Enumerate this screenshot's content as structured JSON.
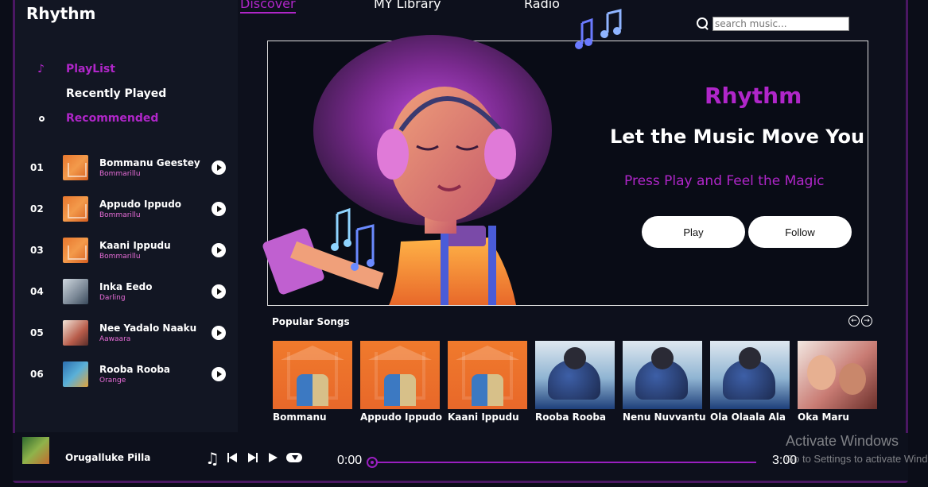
{
  "app": {
    "brand": "Rhythm"
  },
  "nav": {
    "discover": "Discover",
    "library": "MY Library",
    "radio": "Radio"
  },
  "search": {
    "placeholder": "search music..."
  },
  "sidebar": {
    "menu": [
      {
        "label": "PlayList",
        "icon": "music-note-icon"
      },
      {
        "label": "Recently Played",
        "icon": ""
      },
      {
        "label": "Recommended",
        "icon": "circle-icon"
      }
    ],
    "songs": [
      {
        "num": "01",
        "title": "Bommanu Geestey",
        "artist": "Bommarillu"
      },
      {
        "num": "02",
        "title": "Appudo Ippudo",
        "artist": "Bommarillu"
      },
      {
        "num": "03",
        "title": "Kaani Ippudu",
        "artist": "Bommarillu"
      },
      {
        "num": "04",
        "title": "Inka Eedo",
        "artist": "Darling"
      },
      {
        "num": "05",
        "title": "Nee Yadalo Naaku",
        "artist": "Aawaara"
      },
      {
        "num": "06",
        "title": "Rooba Rooba",
        "artist": "Orange"
      }
    ]
  },
  "hero": {
    "brand": "Rhythm",
    "title": "Let the Music Move You",
    "subtitle": "Press Play and Feel the Magic",
    "play_label": "Play",
    "follow_label": "Follow"
  },
  "popular": {
    "title": "Popular Songs",
    "cards": [
      {
        "title": "Bommanu"
      },
      {
        "title": "Appudo Ippudo"
      },
      {
        "title": "Kaani Ippudu"
      },
      {
        "title": "Rooba Rooba"
      },
      {
        "title": "Nenu Nuvvantu"
      },
      {
        "title": "Ola Olaala Ala"
      },
      {
        "title": "Oka Maru"
      }
    ]
  },
  "player": {
    "now_playing": "Orugalluke Pilla",
    "current_time": "0:00",
    "total_time": "3:00",
    "progress": 0
  },
  "watermark": {
    "line1": "Activate Windows",
    "line2": "Go to Settings to activate Windows."
  },
  "colors": {
    "accent": "#b026c9",
    "background": "#0d101c",
    "artist": "#e86dd8"
  }
}
